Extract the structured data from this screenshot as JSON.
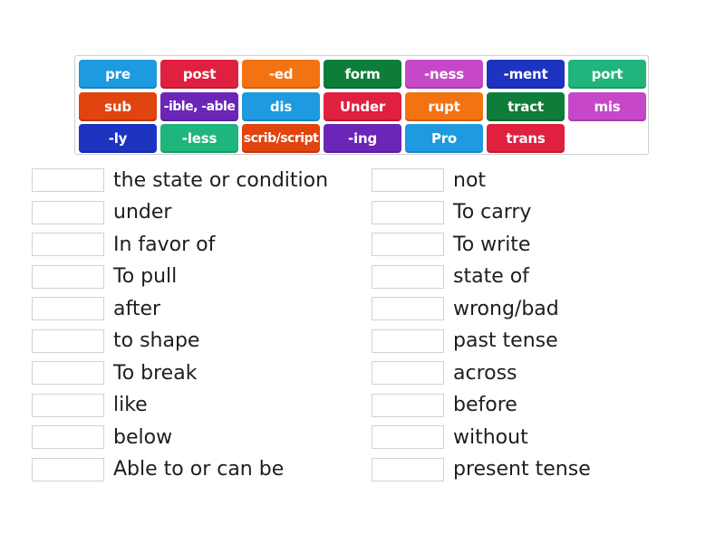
{
  "tiles": [
    {
      "label": "pre",
      "color": "#1e9be0"
    },
    {
      "label": "post",
      "color": "#e0203f"
    },
    {
      "label": "-ed",
      "color": "#f37312"
    },
    {
      "label": "form",
      "color": "#0f7d3a"
    },
    {
      "label": "-ness",
      "color": "#c648c8"
    },
    {
      "label": "-ment",
      "color": "#1c34c0"
    },
    {
      "label": "port",
      "color": "#1fb57c"
    },
    {
      "label": "sub",
      "color": "#e0440f"
    },
    {
      "label": "-ible, -able",
      "color": "#6b26b8"
    },
    {
      "label": "dis",
      "color": "#1e9be0"
    },
    {
      "label": "Under",
      "color": "#e0203f"
    },
    {
      "label": "rupt",
      "color": "#f37312"
    },
    {
      "label": "tract",
      "color": "#0f7d3a"
    },
    {
      "label": "mis",
      "color": "#c648c8"
    },
    {
      "label": "-ly",
      "color": "#1c34c0"
    },
    {
      "label": "-less",
      "color": "#1fb57c"
    },
    {
      "label": "scrib/script",
      "color": "#e0440f"
    },
    {
      "label": "-ing",
      "color": "#6b26b8"
    },
    {
      "label": "Pro",
      "color": "#1e9be0"
    },
    {
      "label": "trans",
      "color": "#e0203f"
    }
  ],
  "left_definitions": [
    "the state or condition",
    "under",
    "In favor of",
    "To pull",
    "after",
    "to shape",
    "To break",
    "like",
    "below",
    "Able to or can be"
  ],
  "right_definitions": [
    "not",
    "To carry",
    "To write",
    "state of",
    "wrong/bad",
    "past tense",
    "across",
    "before",
    "without",
    "present tense"
  ]
}
